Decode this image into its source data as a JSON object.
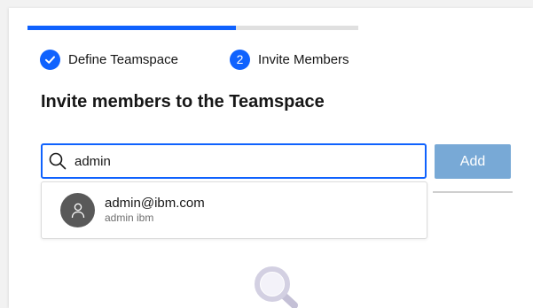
{
  "wizard": {
    "progress": 0.63,
    "steps": [
      {
        "label": "Define Teamspace",
        "state": "completed",
        "icon": "checkmark-icon"
      },
      {
        "number": "2",
        "label": "Invite Members",
        "state": "current"
      }
    ]
  },
  "main": {
    "heading": "Invite members to the Teamspace",
    "search": {
      "value": "admin",
      "icon": "search-icon"
    },
    "add_label": "Add",
    "suggestions": [
      {
        "email": "admin@ibm.com",
        "name": "admin ibm",
        "icon": "user-icon"
      }
    ],
    "empty_state_icon": "magnifier-illustration-icon"
  },
  "colors": {
    "accent": "#0f62fe",
    "button_disabled": "#78a9d6",
    "avatar": "#595959"
  }
}
